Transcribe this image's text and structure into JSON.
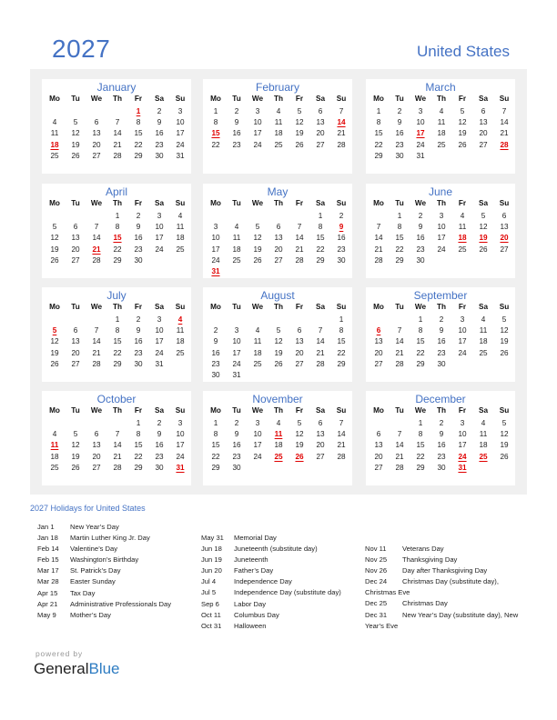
{
  "header": {
    "year": "2027",
    "country": "United States"
  },
  "weekdays": [
    "Mo",
    "Tu",
    "We",
    "Th",
    "Fr",
    "Sa",
    "Su"
  ],
  "colors": {
    "accent": "#4472c4",
    "holiday": "#e00000",
    "panel": "#f0f0f0",
    "brand_blue": "#2e7cc2"
  },
  "months": [
    {
      "name": "January",
      "start": 4,
      "days": 31,
      "holidays": [
        1,
        18
      ]
    },
    {
      "name": "February",
      "start": 0,
      "days": 28,
      "holidays": [
        14,
        15
      ]
    },
    {
      "name": "March",
      "start": 0,
      "days": 31,
      "holidays": [
        17,
        28
      ]
    },
    {
      "name": "April",
      "start": 3,
      "days": 30,
      "holidays": [
        15,
        21
      ]
    },
    {
      "name": "May",
      "start": 5,
      "days": 31,
      "holidays": [
        9,
        31
      ]
    },
    {
      "name": "June",
      "start": 1,
      "days": 30,
      "holidays": [
        18,
        19,
        20
      ]
    },
    {
      "name": "July",
      "start": 3,
      "days": 31,
      "holidays": [
        4,
        5
      ]
    },
    {
      "name": "August",
      "start": 6,
      "days": 31,
      "holidays": []
    },
    {
      "name": "September",
      "start": 2,
      "days": 30,
      "holidays": [
        6
      ]
    },
    {
      "name": "October",
      "start": 4,
      "days": 31,
      "holidays": [
        11,
        31
      ]
    },
    {
      "name": "November",
      "start": 0,
      "days": 30,
      "holidays": [
        11,
        25,
        26
      ]
    },
    {
      "name": "December",
      "start": 2,
      "days": 31,
      "holidays": [
        24,
        25,
        31
      ]
    }
  ],
  "holidays_title": "2027 Holidays for United States",
  "holiday_columns": [
    [
      {
        "date": "Jan 1",
        "name": "New Year’s Day"
      },
      {
        "date": "Jan 18",
        "name": "Martin Luther King Jr. Day"
      },
      {
        "date": "Feb 14",
        "name": "Valentine’s Day"
      },
      {
        "date": "Feb 15",
        "name": "Washington’s Birthday"
      },
      {
        "date": "Mar 17",
        "name": "St. Patrick’s Day"
      },
      {
        "date": "Mar 28",
        "name": "Easter Sunday"
      },
      {
        "date": "Apr 15",
        "name": "Tax Day"
      },
      {
        "date": "Apr 21",
        "name": "Administrative Professionals Day"
      },
      {
        "date": "May 9",
        "name": "Mother’s Day"
      }
    ],
    [
      {
        "date": "May 31",
        "name": "Memorial Day"
      },
      {
        "date": "Jun 18",
        "name": "Juneteenth (substitute day)"
      },
      {
        "date": "Jun 19",
        "name": "Juneteenth"
      },
      {
        "date": "Jun 20",
        "name": "Father’s Day"
      },
      {
        "date": "Jul 4",
        "name": "Independence Day"
      },
      {
        "date": "Jul 5",
        "name": "Independence Day (substitute day)"
      },
      {
        "date": "Sep 6",
        "name": "Labor Day"
      },
      {
        "date": "Oct 11",
        "name": "Columbus Day"
      },
      {
        "date": "Oct 31",
        "name": "Halloween"
      }
    ],
    [
      {
        "date": "Nov 11",
        "name": "Veterans Day"
      },
      {
        "date": "Nov 25",
        "name": "Thanksgiving Day"
      },
      {
        "date": "Nov 26",
        "name": "Day after Thanksgiving Day"
      },
      {
        "date": "Dec 24",
        "name": "Christmas Day (substitute day),",
        "cont": "Christmas Eve"
      },
      {
        "date": "Dec 25",
        "name": "Christmas Day"
      },
      {
        "date": "Dec 31",
        "name": "New Year’s Day (substitute day), New",
        "cont": "Year’s Eve"
      }
    ]
  ],
  "footer": {
    "powered_by": "powered by",
    "brand_general": "General",
    "brand_blue": "Blue"
  }
}
